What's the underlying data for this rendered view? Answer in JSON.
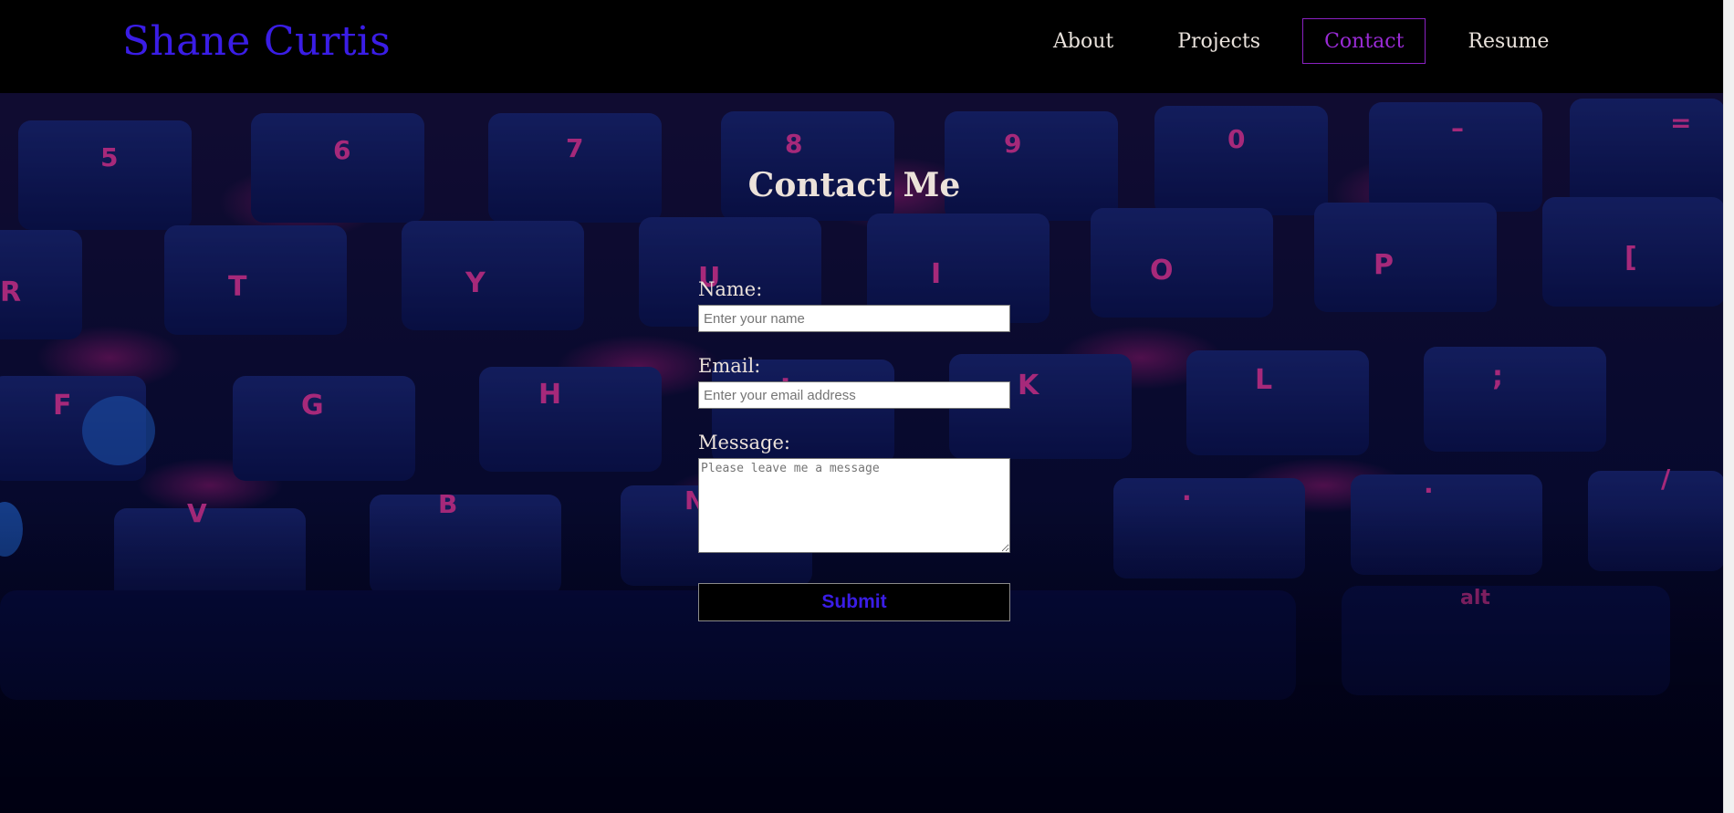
{
  "site": {
    "brand": "Shane Curtis"
  },
  "nav": {
    "items": [
      {
        "label": "About",
        "active": false
      },
      {
        "label": "Projects",
        "active": false
      },
      {
        "label": "Contact",
        "active": true
      },
      {
        "label": "Resume",
        "active": false
      }
    ]
  },
  "contact": {
    "title": "Contact Me",
    "name_label": "Name:",
    "name_placeholder": "Enter your name",
    "name_value": "",
    "email_label": "Email:",
    "email_placeholder": "Enter your email address",
    "email_value": "",
    "message_label": "Message:",
    "message_placeholder": "Please leave me a message",
    "message_value": "",
    "submit_label": "Submit"
  },
  "colors": {
    "brand": "#3a1de6",
    "nav_text": "#e9e2dc",
    "nav_active": "#9a2bd6",
    "key_legend": "#ff3fb0",
    "key_cap": "#0b1450"
  }
}
